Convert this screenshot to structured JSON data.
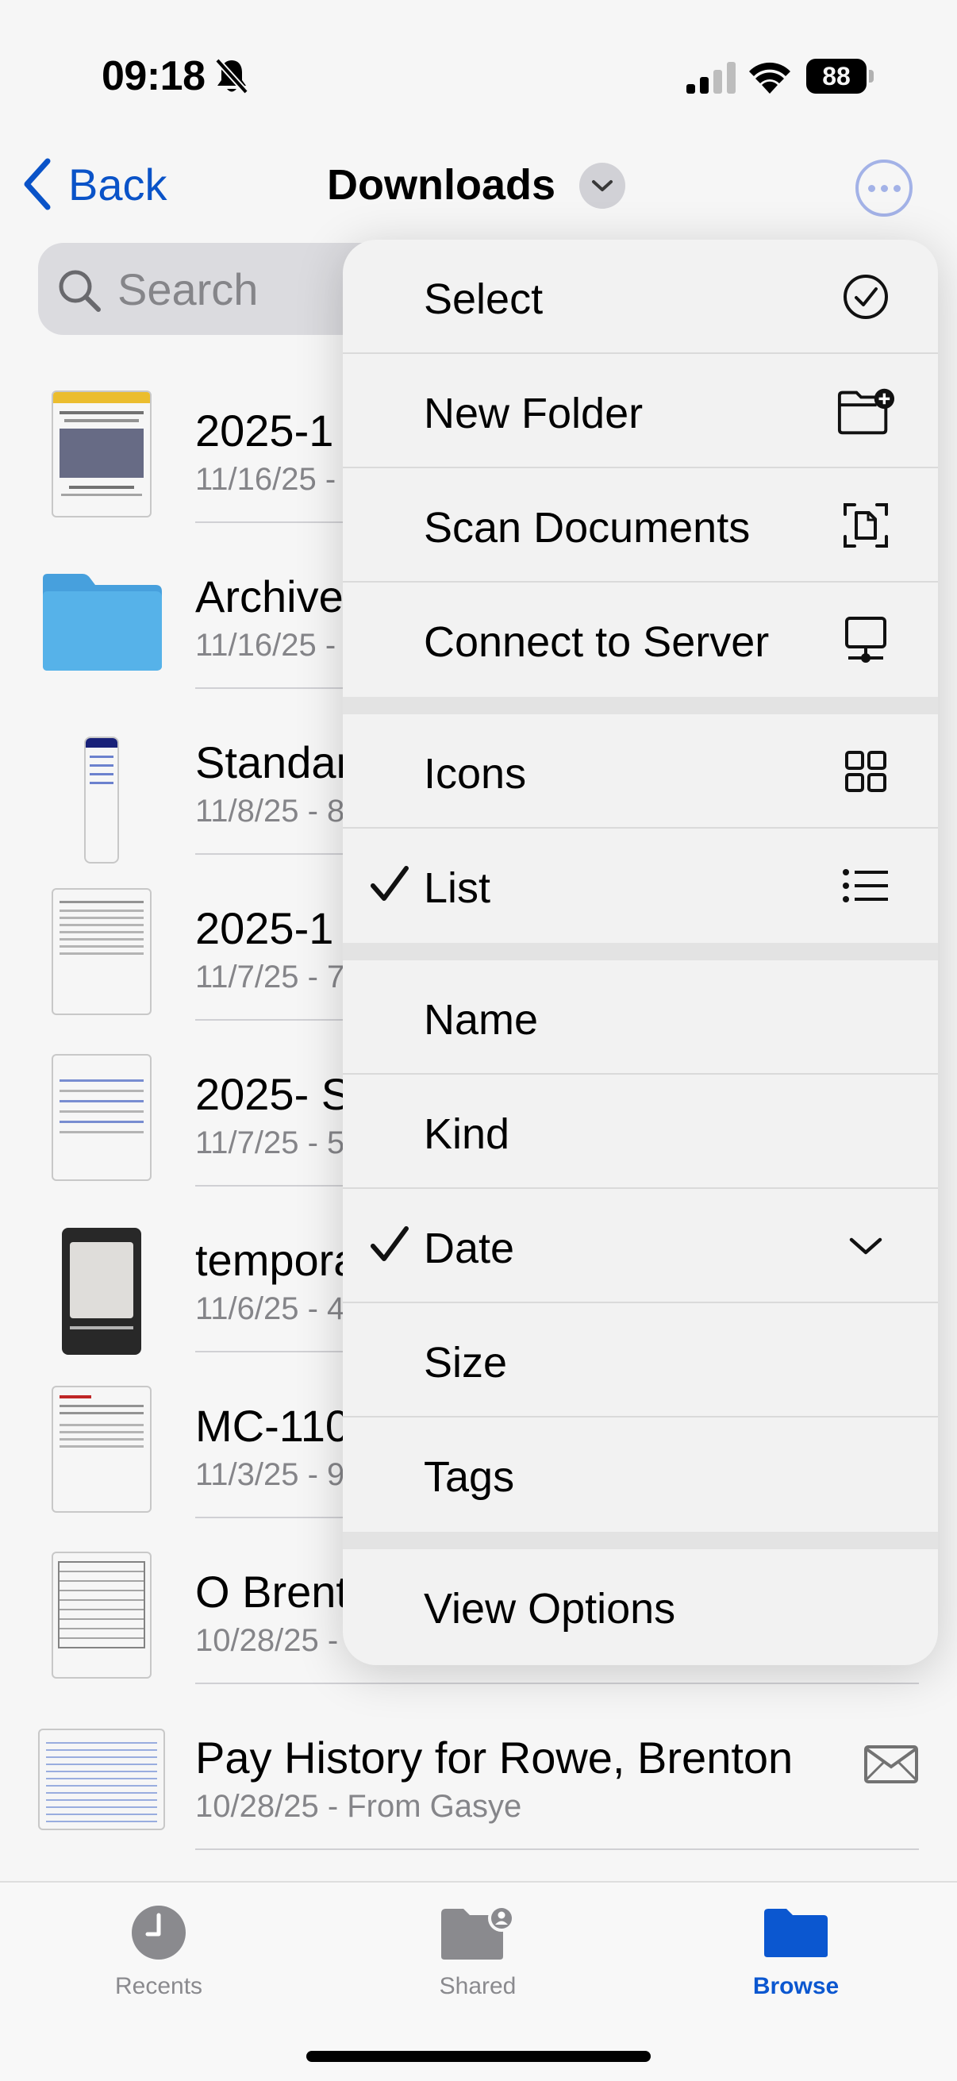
{
  "status_bar": {
    "time": "09:18",
    "battery": "88"
  },
  "nav": {
    "back_label": "Back",
    "title": "Downloads"
  },
  "search": {
    "placeholder": "Search"
  },
  "files": [
    {
      "name": "2025-1",
      "meta": "11/16/25 -",
      "thumb": "document-preview"
    },
    {
      "name": "Archive",
      "meta": "11/16/25 -",
      "thumb": "folder"
    },
    {
      "name": "Standar",
      "meta": "11/8/25 - 8",
      "thumb": "phone-screenshot"
    },
    {
      "name": "2025-1",
      "meta": "11/7/25 - 7",
      "thumb": "document-preview"
    },
    {
      "name": "2025- S",
      "meta": "11/7/25 - 5",
      "thumb": "document-preview"
    },
    {
      "name": "tempora",
      "meta": "11/6/25 - 4",
      "thumb": "photo"
    },
    {
      "name": "MC-110",
      "meta": "11/3/25 - 9",
      "thumb": "document-preview"
    },
    {
      "name": "O Brent",
      "meta": "10/28/25 -",
      "thumb": "document-preview"
    },
    {
      "name": "Pay History for Rowe, Brenton",
      "meta": "10/28/25 - From Gasye",
      "thumb": "spreadsheet"
    }
  ],
  "menu": {
    "groups": [
      [
        {
          "label": "Select",
          "icon": "checkmark-circle-icon"
        },
        {
          "label": "New Folder",
          "icon": "folder-plus-icon"
        },
        {
          "label": "Scan Documents",
          "icon": "scan-document-icon"
        },
        {
          "label": "Connect to Server",
          "icon": "server-monitor-icon"
        }
      ],
      [
        {
          "label": "Icons",
          "icon": "grid-icon"
        },
        {
          "label": "List",
          "icon": "list-icon",
          "checked": true
        }
      ],
      [
        {
          "label": "Name"
        },
        {
          "label": "Kind"
        },
        {
          "label": "Date",
          "icon": "chevron-down-icon",
          "checked": true
        },
        {
          "label": "Size"
        },
        {
          "label": "Tags"
        }
      ],
      [
        {
          "label": "View Options"
        }
      ]
    ]
  },
  "tabbar": {
    "tabs": [
      {
        "label": "Recents",
        "icon": "clock-icon"
      },
      {
        "label": "Shared",
        "icon": "shared-folder-icon"
      },
      {
        "label": "Browse",
        "icon": "folder-icon",
        "active": true
      }
    ]
  },
  "colors": {
    "accent": "#0b57d0",
    "folder": "#5ab4ef",
    "secondary_text": "#8a8a8e"
  }
}
